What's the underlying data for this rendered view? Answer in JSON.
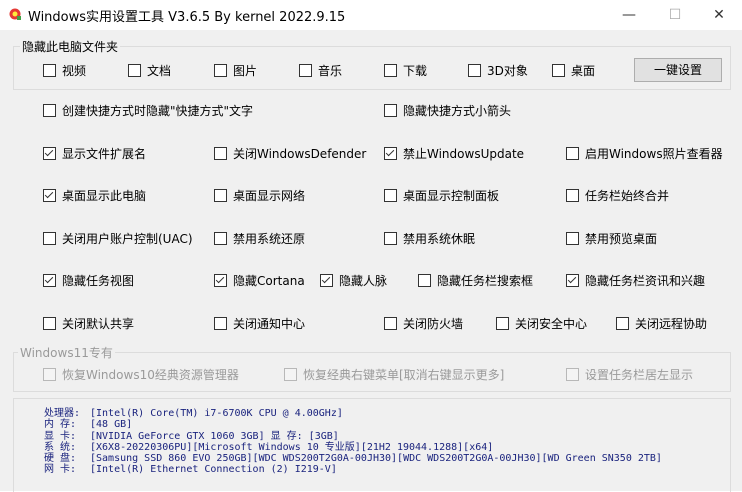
{
  "window": {
    "title": "Windows实用设置工具 V3.6.5 By kernel 2022.9.15",
    "minimize": "—",
    "maximize": "☐",
    "close": "✕"
  },
  "hide_group": {
    "label": "隐藏此电脑文件夹",
    "items": [
      {
        "label": "视频",
        "checked": false
      },
      {
        "label": "文档",
        "checked": false
      },
      {
        "label": "图片",
        "checked": false
      },
      {
        "label": "音乐",
        "checked": false
      },
      {
        "label": "下载",
        "checked": false
      },
      {
        "label": "3D对象",
        "checked": false
      },
      {
        "label": "桌面",
        "checked": false
      }
    ],
    "one_click_button": "一键设置"
  },
  "options": [
    {
      "label": "创建快捷方式时隐藏\"快捷方式\"文字",
      "checked": false
    },
    {
      "label": "隐藏快捷方式小箭头",
      "checked": false
    },
    {
      "label": "显示文件扩展名",
      "checked": true
    },
    {
      "label": "关闭WindowsDefender",
      "checked": false
    },
    {
      "label": "禁止WindowsUpdate",
      "checked": true
    },
    {
      "label": "启用Windows照片查看器",
      "checked": false
    },
    {
      "label": "桌面显示此电脑",
      "checked": true
    },
    {
      "label": "桌面显示网络",
      "checked": false
    },
    {
      "label": "桌面显示控制面板",
      "checked": false
    },
    {
      "label": "任务栏始终合并",
      "checked": false
    },
    {
      "label": "关闭用户账户控制(UAC)",
      "checked": false
    },
    {
      "label": "禁用系统还原",
      "checked": false
    },
    {
      "label": "禁用系统休眠",
      "checked": false
    },
    {
      "label": "禁用预览桌面",
      "checked": false
    },
    {
      "label": "隐藏任务视图",
      "checked": true
    },
    {
      "label": "隐藏Cortana",
      "checked": true
    },
    {
      "label": "隐藏人脉",
      "checked": true
    },
    {
      "label": "隐藏任务栏搜索框",
      "checked": false
    },
    {
      "label": "隐藏任务栏资讯和兴趣",
      "checked": true
    },
    {
      "label": "关闭默认共享",
      "checked": false
    },
    {
      "label": "关闭通知中心",
      "checked": false
    },
    {
      "label": "关闭防火墙",
      "checked": false
    },
    {
      "label": "关闭安全中心",
      "checked": false
    },
    {
      "label": "关闭远程协助",
      "checked": false
    }
  ],
  "win11_group": {
    "label": "Windows11专有",
    "items": [
      {
        "label": "恢复Windows10经典资源管理器",
        "checked": false
      },
      {
        "label": "恢复经典右键菜单[取消右键显示更多]",
        "checked": false
      },
      {
        "label": "设置任务栏居左显示",
        "checked": false
      }
    ]
  },
  "system_info": [
    {
      "label": "处理器:",
      "value": "[Intel(R) Core(TM) i7-6700K CPU @ 4.00GHz]"
    },
    {
      "label": "内  存:",
      "value": "[48 GB]"
    },
    {
      "label": "显  卡:",
      "value": "[NVIDIA GeForce GTX 1060 3GB]  显 存: [3GB]"
    },
    {
      "label": "系  统:",
      "value": "[X6X8-20220306PU][Microsoft Windows 10 专业版][21H2 19044.1288][x64]"
    },
    {
      "label": "硬  盘:",
      "value": "[Samsung SSD 860 EVO 250GB][WDC WDS200T2G0A-00JH30][WDC WDS200T2G0A-00JH30][WD Green SN350 2TB]"
    },
    {
      "label": "网  卡:",
      "value": "[Intel(R) Ethernet Connection (2) I219-V]"
    }
  ]
}
